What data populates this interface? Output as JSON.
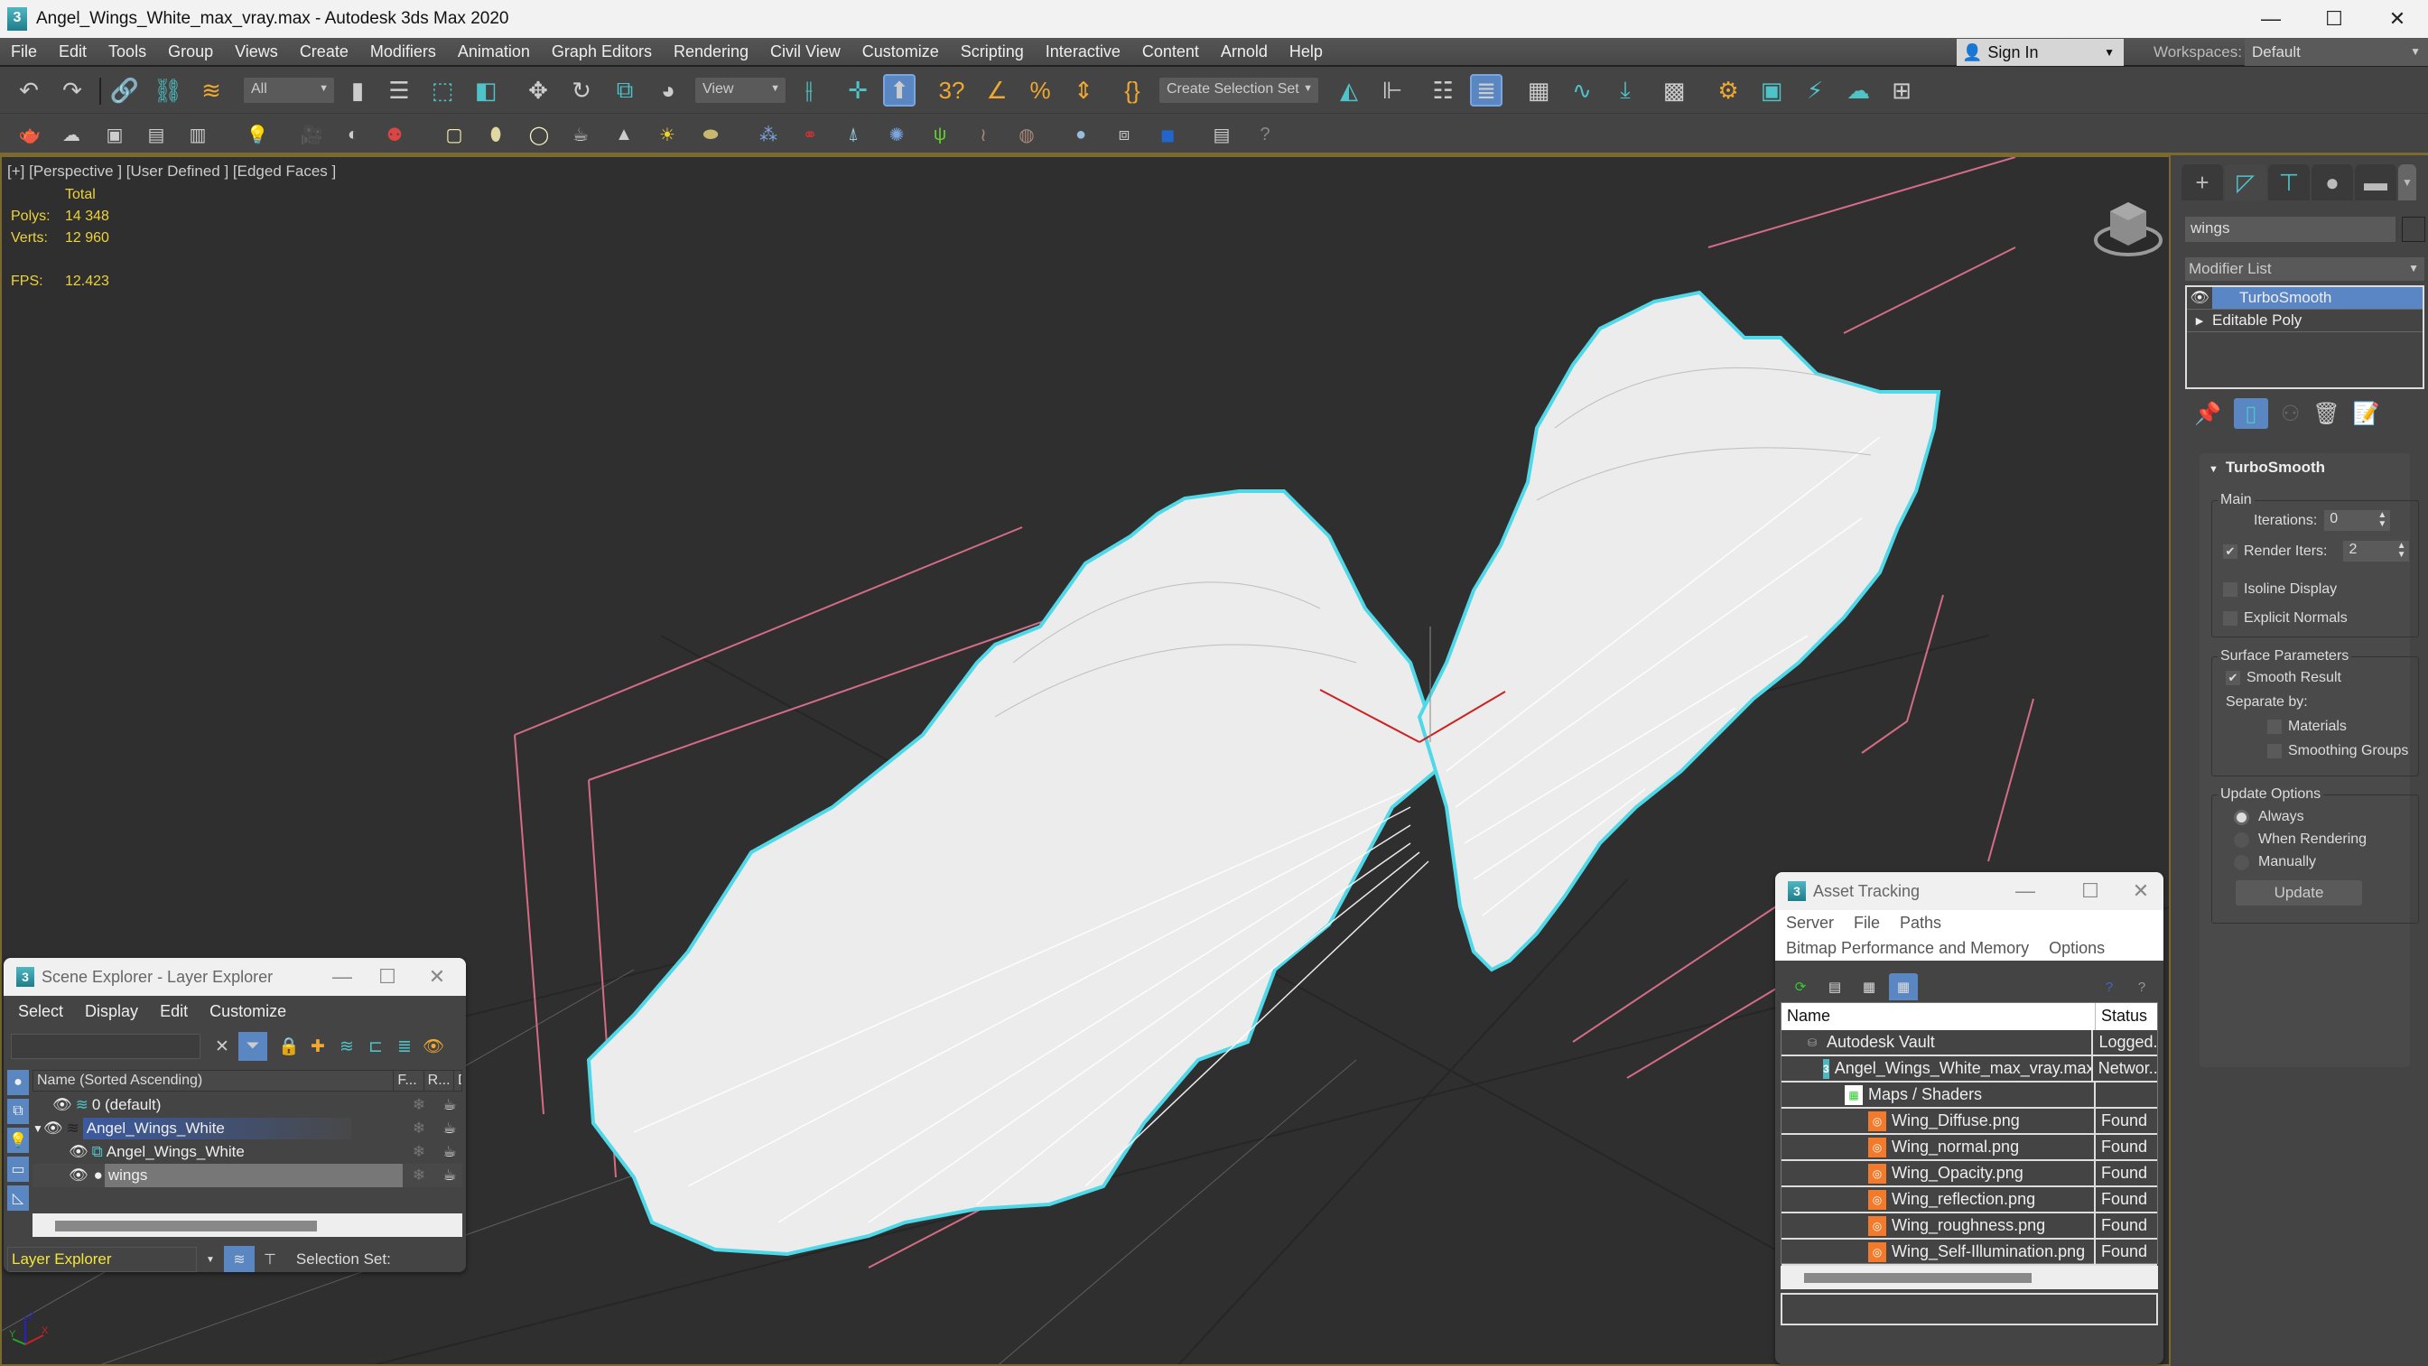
{
  "window": {
    "title": "Angel_Wings_White_max_vray.max - Autodesk 3ds Max 2020",
    "app_icon": "3ds-max-logo",
    "controls": [
      "minimize",
      "maximize",
      "close"
    ]
  },
  "menubar": {
    "items": [
      "File",
      "Edit",
      "Tools",
      "Group",
      "Views",
      "Create",
      "Modifiers",
      "Animation",
      "Graph Editors",
      "Rendering",
      "Civil View",
      "Customize",
      "Scripting",
      "Interactive",
      "Content",
      "Arnold",
      "Help"
    ],
    "sign_in": "Sign In",
    "workspaces_label": "Workspaces:",
    "workspace_value": "Default"
  },
  "toolbar": {
    "selection_filter": "All",
    "reference_coord": "View",
    "selection_set_placeholder": "Create Selection Set",
    "main_icons": [
      "undo-icon",
      "redo-icon",
      "link-icon",
      "unlink-icon",
      "bind-space-warp-icon",
      "select-object-icon",
      "select-by-name-icon",
      "rect-selection-region-icon",
      "window-crossing-icon",
      "move-icon",
      "rotate-icon",
      "scale-icon",
      "placement-icon",
      "pivot-icon",
      "manipulate-icon",
      "keyboard-shortcut-icon",
      "snaps-3d-icon",
      "angle-snap-icon",
      "percent-snap-icon",
      "spinner-snap-icon",
      "edit-named-sets-icon",
      "mirror-icon",
      "align-icon",
      "toggle-scene-explorer-icon",
      "toggle-layer-explorer-icon",
      "ribbon-icon",
      "curve-editor-icon",
      "schematic-view-icon",
      "material-editor-icon",
      "render-setup-icon",
      "rendered-frame-window-icon",
      "render-production-icon",
      "render-cloud-icon",
      "render-iterative-icon"
    ],
    "second_row_icons": [
      "teapot-icon",
      "cloud-icon",
      "render-window-icon",
      "settings-panel-icon",
      "settings-panel-2-icon",
      "light-lister-icon",
      "camera-icon",
      "physical-camera-icon",
      "camera-sequence-icon",
      "plane-light-icon",
      "sphere-light-icon",
      "dome-light-icon",
      "teapot-mesh-icon",
      "cone-icon",
      "sun-icon",
      "ies-light-icon",
      "fur-icon",
      "molecule-icon",
      "tower-icon",
      "scatter-icon",
      "grass-icon",
      "hair-fur-icon",
      "displacement-icon",
      "material-sphere-icon",
      "material-browser-icon",
      "proxy-icon",
      "scene-converter-icon",
      "help-icon"
    ]
  },
  "viewport": {
    "label": "[+] [Perspective ] [User Defined ] [Edged Faces ]",
    "stats": {
      "header": "Total",
      "polys_label": "Polys:",
      "polys": "14 348",
      "verts_label": "Verts:",
      "verts": "12 960",
      "fps_label": "FPS:",
      "fps": "12.423"
    },
    "object": "angel-wings-white",
    "selection_color": "#4fd8e8",
    "axis_labels": [
      "X",
      "Y",
      "Z"
    ]
  },
  "command_panel": {
    "tabs": [
      "create",
      "modify",
      "hierarchy",
      "motion",
      "display",
      "utilities"
    ],
    "active_tab": "modify",
    "object_name": "wings",
    "modifier_list": "Modifier List",
    "stack": [
      {
        "label": "TurboSmooth",
        "selected": true
      },
      {
        "label": "Editable Poly",
        "selected": false
      }
    ],
    "rollout": {
      "title": "TurboSmooth",
      "main_group": "Main",
      "iterations_label": "Iterations:",
      "iterations": "0",
      "render_iters_label": "Render Iters:",
      "render_iters": "2",
      "render_iters_checked": true,
      "isoline_label": "Isoline Display",
      "isoline_checked": false,
      "explicit_normals_label": "Explicit Normals",
      "explicit_normals_checked": false,
      "surface_group": "Surface Parameters",
      "smooth_result_label": "Smooth Result",
      "smooth_result_checked": true,
      "separate_by_label": "Separate by:",
      "materials_label": "Materials",
      "smoothing_groups_label": "Smoothing Groups",
      "update_group": "Update Options",
      "update_options": [
        "Always",
        "When Rendering",
        "Manually"
      ],
      "update_selected": "Always",
      "update_button": "Update"
    }
  },
  "scene_explorer": {
    "title": "Scene Explorer - Layer Explorer",
    "menu": [
      "Select",
      "Display",
      "Edit",
      "Customize"
    ],
    "columns": [
      "Name (Sorted Ascending)",
      "F...",
      "R...",
      "Disp"
    ],
    "rows": [
      {
        "name": "0 (default)",
        "type": "layer",
        "indent": 0
      },
      {
        "name": "Angel_Wings_White",
        "type": "layer",
        "indent": 0,
        "selected": true,
        "expanded": true
      },
      {
        "name": "Angel_Wings_White",
        "type": "group",
        "indent": 1
      },
      {
        "name": "wings",
        "type": "object",
        "indent": 1,
        "highlighted": true
      }
    ],
    "explorer_mode": "Layer Explorer",
    "selection_set_label": "Selection Set:"
  },
  "asset_tracking": {
    "title": "Asset Tracking",
    "menu1": [
      "Server",
      "File",
      "Paths"
    ],
    "menu2": [
      "Bitmap Performance and Memory",
      "Options"
    ],
    "columns": [
      "Name",
      "Status"
    ],
    "rows": [
      {
        "name": "Autodesk Vault",
        "status": "Logged.",
        "indent": 1,
        "icon": "vault-icon"
      },
      {
        "name": "Angel_Wings_White_max_vray.max",
        "status": "Networ..",
        "indent": 2,
        "icon": "max-file-icon"
      },
      {
        "name": "Maps / Shaders",
        "status": "",
        "indent": 3,
        "icon": "maps-icon"
      },
      {
        "name": "Wing_Diffuse.png",
        "status": "Found",
        "indent": 4,
        "icon": "png-icon"
      },
      {
        "name": "Wing_normal.png",
        "status": "Found",
        "indent": 4,
        "icon": "png-icon"
      },
      {
        "name": "Wing_Opacity.png",
        "status": "Found",
        "indent": 4,
        "icon": "png-icon"
      },
      {
        "name": "Wing_reflection.png",
        "status": "Found",
        "indent": 4,
        "icon": "png-icon"
      },
      {
        "name": "Wing_roughness.png",
        "status": "Found",
        "indent": 4,
        "icon": "png-icon"
      },
      {
        "name": "Wing_Self-Illumination.png",
        "status": "Found",
        "indent": 4,
        "icon": "png-icon"
      }
    ]
  }
}
